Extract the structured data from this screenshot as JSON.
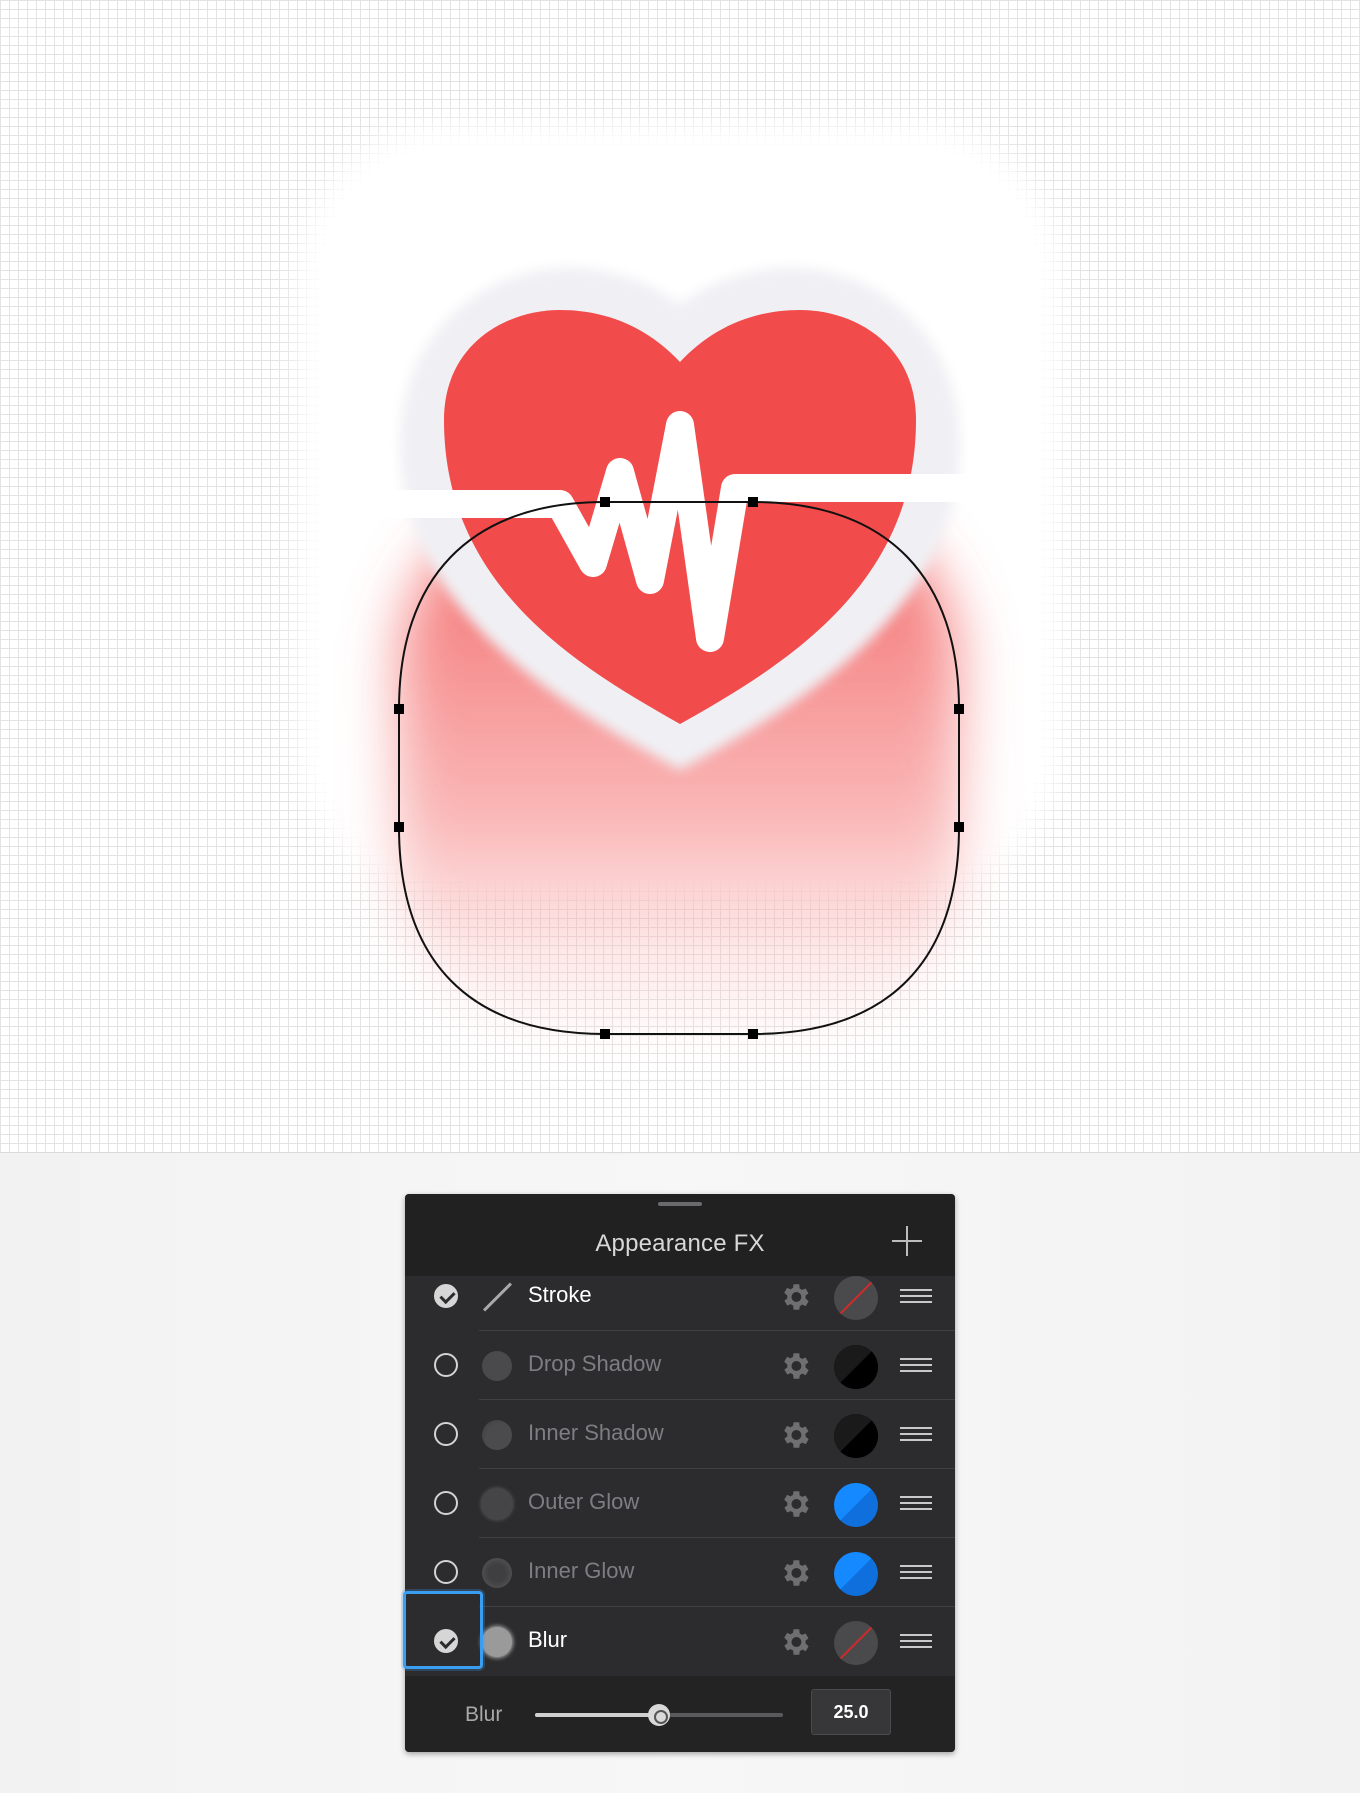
{
  "panel": {
    "title": "Appearance FX",
    "effects": [
      {
        "label": "Stroke",
        "enabled": true,
        "icon": "stroke-icon",
        "swatch": "none"
      },
      {
        "label": "Drop Shadow",
        "enabled": false,
        "icon": "drop-shadow-icon",
        "swatch": "black"
      },
      {
        "label": "Inner Shadow",
        "enabled": false,
        "icon": "inner-shadow-icon",
        "swatch": "black"
      },
      {
        "label": "Outer Glow",
        "enabled": false,
        "icon": "outer-glow-icon",
        "swatch": "blue"
      },
      {
        "label": "Inner Glow",
        "enabled": false,
        "icon": "inner-glow-icon",
        "swatch": "blue"
      },
      {
        "label": "Blur",
        "enabled": true,
        "icon": "blur-icon",
        "swatch": "none"
      }
    ],
    "blur": {
      "label": "Blur",
      "value": "25.0",
      "slider_fraction": 0.5
    }
  },
  "colors": {
    "heart": "#f24b4b",
    "accent_blue": "#1589ff",
    "panel_bg": "#2c2c2e",
    "selection_outline": "#3b9df0"
  }
}
